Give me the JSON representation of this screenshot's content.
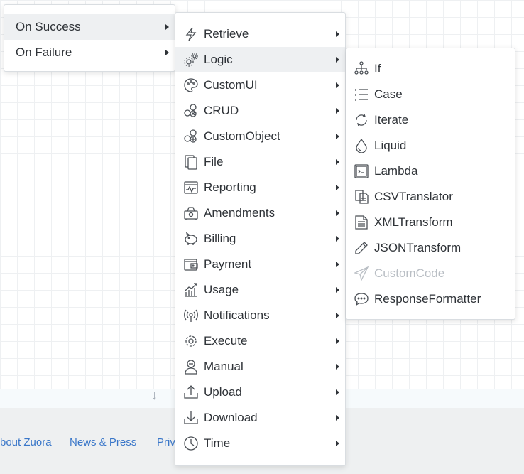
{
  "footer": {
    "links": [
      "bout Zuora",
      "News & Press",
      "Priv"
    ]
  },
  "menu1": {
    "items": [
      {
        "label": "On Success"
      },
      {
        "label": "On Failure"
      }
    ]
  },
  "menu2": {
    "items": [
      {
        "label": "Retrieve",
        "icon": "lightning-icon"
      },
      {
        "label": "Logic",
        "icon": "gears-icon"
      },
      {
        "label": "CustomUI",
        "icon": "palette-icon"
      },
      {
        "label": "CRUD",
        "icon": "crud-icon"
      },
      {
        "label": "CustomObject",
        "icon": "custom-object-icon"
      },
      {
        "label": "File",
        "icon": "file-icon"
      },
      {
        "label": "Reporting",
        "icon": "reporting-icon"
      },
      {
        "label": "Amendments",
        "icon": "amendments-icon"
      },
      {
        "label": "Billing",
        "icon": "piggy-bank-icon"
      },
      {
        "label": "Payment",
        "icon": "wallet-icon"
      },
      {
        "label": "Usage",
        "icon": "usage-chart-icon"
      },
      {
        "label": "Notifications",
        "icon": "broadcast-icon"
      },
      {
        "label": "Execute",
        "icon": "gear-icon"
      },
      {
        "label": "Manual",
        "icon": "person-icon"
      },
      {
        "label": "Upload",
        "icon": "upload-icon"
      },
      {
        "label": "Download",
        "icon": "download-icon"
      },
      {
        "label": "Time",
        "icon": "clock-icon"
      }
    ]
  },
  "menu3": {
    "items": [
      {
        "label": "If",
        "icon": "branch-icon"
      },
      {
        "label": "Case",
        "icon": "list-icon"
      },
      {
        "label": "Iterate",
        "icon": "loop-icon"
      },
      {
        "label": "Liquid",
        "icon": "drop-icon"
      },
      {
        "label": "Lambda",
        "icon": "terminal-icon"
      },
      {
        "label": "CSVTranslator",
        "icon": "csv-icon"
      },
      {
        "label": "XMLTransform",
        "icon": "document-icon"
      },
      {
        "label": "JSONTransform",
        "icon": "pencil-icon"
      },
      {
        "label": "CustomCode",
        "icon": "send-icon",
        "disabled": true
      },
      {
        "label": "ResponseFormatter",
        "icon": "chat-icon"
      }
    ]
  }
}
